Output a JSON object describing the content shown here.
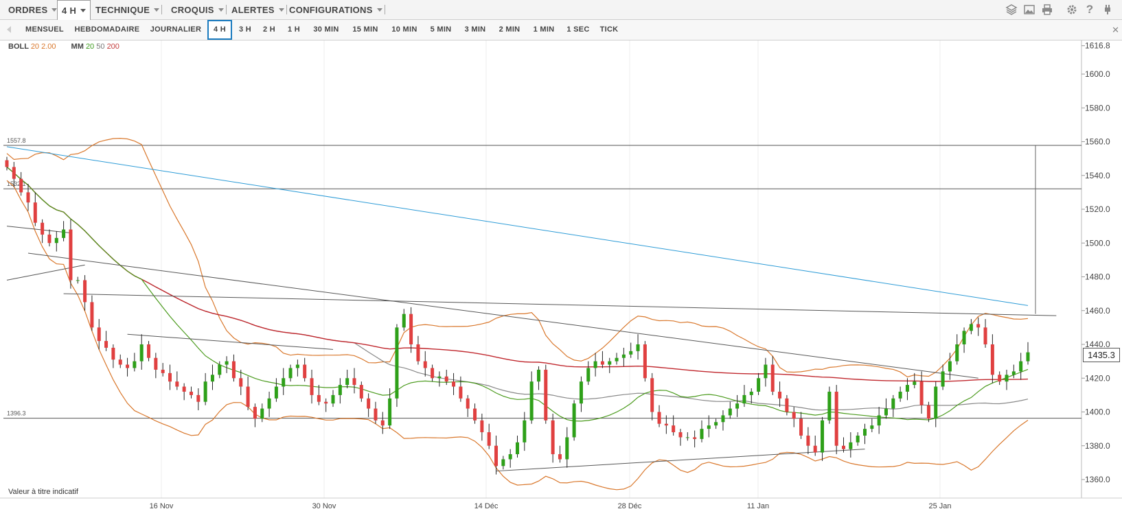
{
  "toolbar": {
    "menus": [
      {
        "label": "ORDRES"
      },
      {
        "label": "4 H"
      },
      {
        "label": "TECHNIQUE"
      },
      {
        "label": "CROQUIS"
      },
      {
        "label": "ALERTES"
      },
      {
        "label": "CONFIGURATIONS"
      }
    ],
    "icons": [
      "layers-icon",
      "image-icon",
      "print-icon",
      "gear-icon",
      "help-icon",
      "plug-icon"
    ]
  },
  "timeframes": {
    "items": [
      "MENSUEL",
      "HEBDOMADAIRE",
      "JOURNALIER",
      "4 H",
      "3 H",
      "2 H",
      "1 H",
      "30 MIN",
      "15 MIN",
      "10 MIN",
      "5 MIN",
      "3 MIN",
      "2 MIN",
      "1 MIN",
      "1 SEC",
      "TICK"
    ],
    "selected": "4 H"
  },
  "legend": {
    "boll_label": "BOLL",
    "boll_period": "20",
    "boll_dev": "2.00",
    "mm_label": "MM",
    "mm1": "20",
    "mm2": "50",
    "mm3": "200"
  },
  "note": "Valeur à titre indicatif",
  "last_price": "1435.3",
  "chart_data": {
    "type": "candlestick",
    "x_tick_labels": [
      "16 Nov",
      "30 Nov",
      "14 Déc",
      "28 Déc",
      "11 Jan",
      "25 Jan"
    ],
    "y_tick_labels": [
      "1616.8",
      "1600.0",
      "1580.0",
      "1560.0",
      "1540.0",
      "1520.0",
      "1500.0",
      "1480.0",
      "1460.0",
      "1440.0",
      "1420.0",
      "1400.0",
      "1380.0",
      "1360.0"
    ],
    "ylim": [
      1355,
      1620
    ],
    "horizontal_levels": [
      {
        "value": 1557.8,
        "label": "1557.8"
      },
      {
        "value": 1532.1,
        "label": "1532.1"
      },
      {
        "value": 1396.3,
        "label": "1396.3"
      }
    ],
    "last_value": 1435.3,
    "colors": {
      "up": "#2ea019",
      "down": "#e04040",
      "boll": "#d9772b",
      "mm20": "#4a9a1c",
      "mm50": "#888888",
      "mm200": "#c0272d",
      "trend_blue": "#2a9ad6"
    },
    "series": [
      {
        "name": "close",
        "values": [
          1545,
          1538,
          1530,
          1524,
          1512,
          1505,
          1500,
          1503,
          1508,
          1478,
          1478,
          1465,
          1450,
          1442,
          1438,
          1431,
          1428,
          1426,
          1430,
          1440,
          1432,
          1425,
          1423,
          1418,
          1415,
          1412,
          1410,
          1406,
          1418,
          1422,
          1428,
          1430,
          1420,
          1415,
          1403,
          1396,
          1402,
          1408,
          1415,
          1420,
          1426,
          1428,
          1420,
          1410,
          1406,
          1405,
          1410,
          1416,
          1420,
          1416,
          1408,
          1402,
          1395,
          1392,
          1408,
          1450,
          1458,
          1440,
          1430,
          1426,
          1420,
          1421,
          1418,
          1415,
          1408,
          1402,
          1395,
          1388,
          1380,
          1368,
          1372,
          1375,
          1382,
          1395,
          1418,
          1425,
          1395,
          1375,
          1372,
          1385,
          1405,
          1418,
          1426,
          1430,
          1428,
          1430,
          1432,
          1434,
          1436,
          1440,
          1420,
          1400,
          1393,
          1392,
          1388,
          1385,
          1385,
          1384,
          1390,
          1392,
          1394,
          1398,
          1402,
          1405,
          1410,
          1412,
          1420,
          1428,
          1412,
          1408,
          1400,
          1396,
          1386,
          1380,
          1376,
          1395,
          1412,
          1380,
          1378,
          1382,
          1386,
          1390,
          1392,
          1398,
          1402,
          1408,
          1412,
          1416,
          1418,
          1404,
          1396,
          1415,
          1424,
          1430,
          1440,
          1448,
          1452,
          1450,
          1440,
          1422,
          1418,
          1422,
          1424,
          1430,
          1435.3
        ]
      }
    ]
  }
}
